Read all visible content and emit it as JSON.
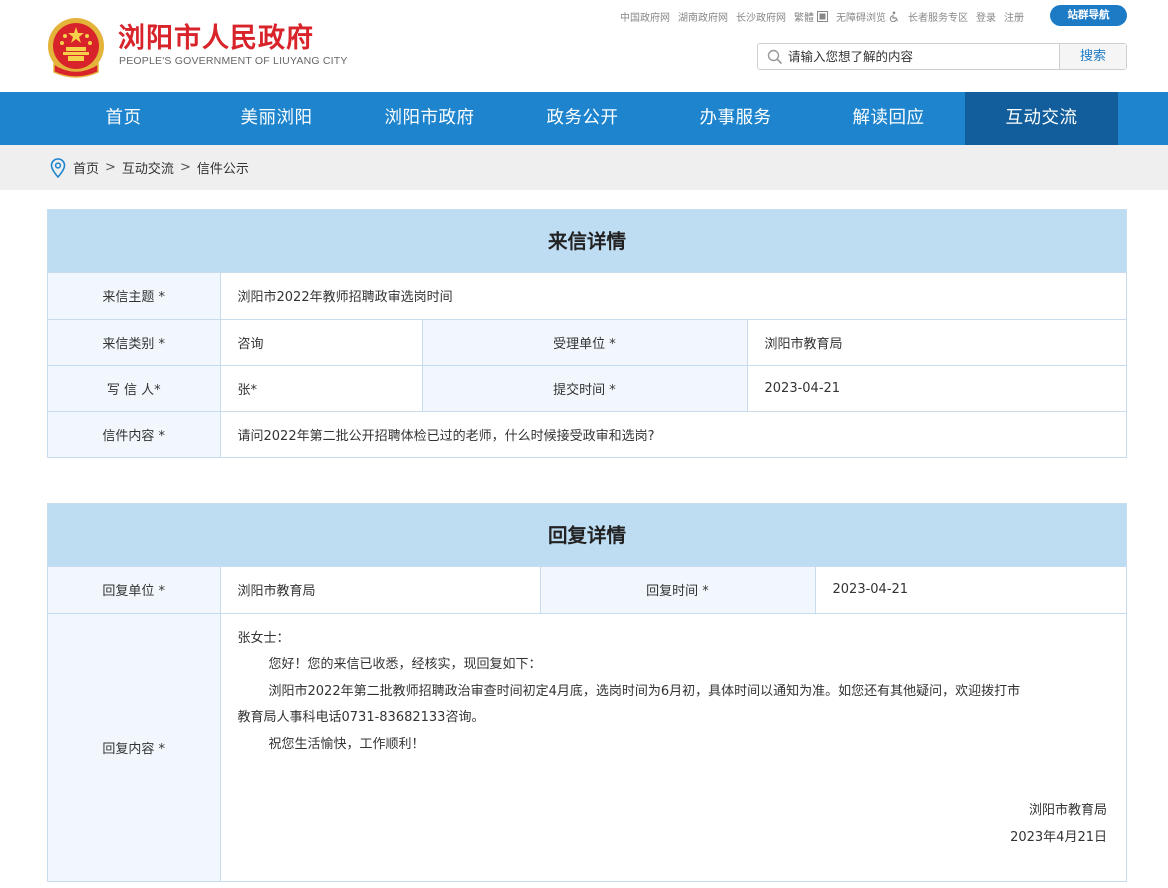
{
  "header": {
    "site_name": "浏阳市人民政府",
    "site_name_en": "PEOPLE'S GOVERNMENT OF LIUYANG CITY",
    "toplinks": [
      "中国政府网",
      "湖南政府网",
      "长沙政府网",
      "繁體",
      "无障碍浏览",
      "长者服务专区",
      "登录",
      "注册"
    ],
    "nav_button": "站群导航",
    "search": {
      "placeholder": "请输入您想了解的内容",
      "button": "搜索"
    }
  },
  "nav": [
    "首页",
    "美丽浏阳",
    "浏阳市政府",
    "政务公开",
    "办事服务",
    "解读回应",
    "互动交流"
  ],
  "nav_active_index": 6,
  "breadcrumb": [
    "首页",
    "互动交流",
    "信件公示"
  ],
  "letter": {
    "title": "来信详情",
    "subject_label": "来信主题 *",
    "subject": "浏阳市2022年教师招聘政审选岗时间",
    "category_label": "来信类别 *",
    "category": "咨询",
    "unit_label": "受理单位 *",
    "unit": "浏阳市教育局",
    "writer_label": "写 信 人*",
    "writer": "张*",
    "submit_label": "提交时间 *",
    "submit_time": "2023-04-21",
    "content_label": "信件内容 *",
    "content": "请问2022年第二批公开招聘体检已过的老师，什么时候接受政审和选岗?"
  },
  "reply": {
    "title": "回复详情",
    "unit_label": "回复单位 *",
    "unit": "浏阳市教育局",
    "time_label": "回复时间 *",
    "time": "2023-04-21",
    "content_label": "回复内容 *",
    "greeting": "张女士：",
    "line1": "您好！您的来信已收悉，经核实，现回复如下：",
    "line2": "浏阳市2022年第二批教师招聘政治审查时间初定4月底，选岗时间为6月初，具体时间以通知为准。如您还有其他疑问，欢迎拨打市",
    "line2b": "教育局人事科电话0731-83682133咨询。",
    "line3": "祝您生活愉快，工作顺利！",
    "sign_org": "浏阳市教育局",
    "sign_date": "2023年4月21日"
  },
  "colors": {
    "brand_red": "#d8232a",
    "nav_blue": "#1d84cd",
    "nav_active": "#125e9c",
    "title_bg": "#bedcf2"
  }
}
